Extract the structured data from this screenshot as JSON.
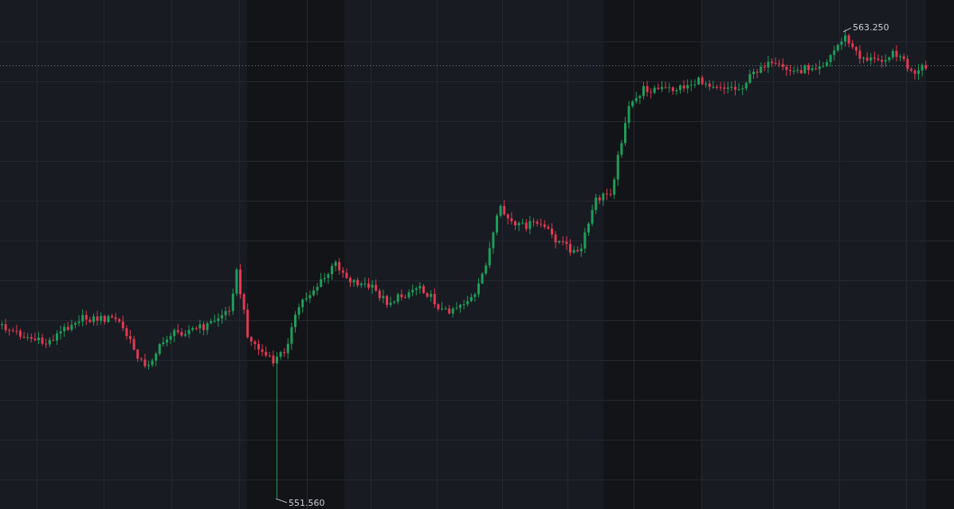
{
  "chart": {
    "high_label": "563.250",
    "low_label": "551.560"
  }
}
